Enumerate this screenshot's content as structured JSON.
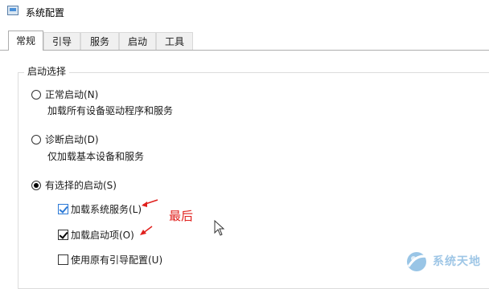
{
  "window": {
    "title": "系统配置"
  },
  "tabs": [
    {
      "label": "常规",
      "active": true
    },
    {
      "label": "引导",
      "active": false
    },
    {
      "label": "服务",
      "active": false
    },
    {
      "label": "启动",
      "active": false
    },
    {
      "label": "工具",
      "active": false
    }
  ],
  "startup_selection": {
    "legend": "启动选择",
    "normal": {
      "label": "正常启动(N)",
      "description": "加载所有设备驱动程序和服务",
      "selected": false
    },
    "diagnostic": {
      "label": "诊断启动(D)",
      "description": "仅加载基本设备和服务",
      "selected": false
    },
    "selective": {
      "label": "有选择的启动(S)",
      "selected": true,
      "options": [
        {
          "label": "加载系统服务(L)",
          "checked": true
        },
        {
          "label": "加载启动项(O)",
          "checked": true
        },
        {
          "label": "使用原有引导配置(U)",
          "checked": false
        }
      ]
    }
  },
  "annotation": {
    "text": "最后",
    "color": "#e0201d"
  },
  "watermark": {
    "text": "系统天地"
  }
}
